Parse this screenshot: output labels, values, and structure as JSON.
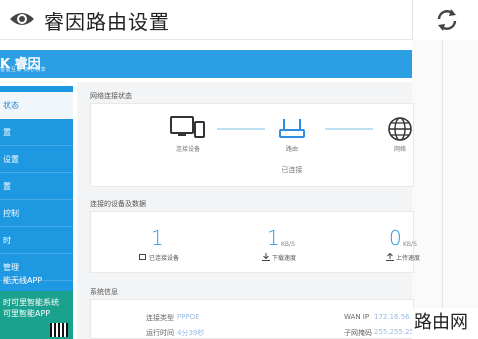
{
  "header": {
    "title": "睿因路由设置",
    "eye_icon": "eye-icon",
    "refresh_icon": "refresh-icon"
  },
  "brand": {
    "logo": "K 睿因",
    "slogan": "智能互联 随心畅享"
  },
  "sidebar": {
    "items": [
      {
        "label": "状态",
        "active": true
      },
      {
        "label": "置"
      },
      {
        "label": "设置"
      },
      {
        "label": "置"
      },
      {
        "label": "控制"
      },
      {
        "label": "时"
      },
      {
        "label": "管理"
      },
      {
        "label": "能无线APP"
      }
    ],
    "promo_line1": "时可里智能系统",
    "promo_line2": "可里智能APP"
  },
  "network_status": {
    "title": "网络连接状态",
    "device_label": "连接设备",
    "router_label": "路由",
    "internet_label": "网络",
    "state": "已连接"
  },
  "devices": {
    "title": "连接的设备及数据",
    "connected_count": "1",
    "connected_label": "已连接设备",
    "download_value": "1",
    "download_unit": "KB/S",
    "download_label": "下载速度",
    "upload_value": "0",
    "upload_unit": "KB/S",
    "upload_label": "上传速度"
  },
  "system": {
    "title": "系统信息",
    "conn_type_label": "连接类型",
    "conn_type_value": "PPPOE",
    "uptime_label": "运行时间",
    "uptime_value": "4分39秒",
    "wan_ip_label": "WAN IP",
    "wan_ip_value": "172.16.56.26",
    "subnet_label": "子网掩码",
    "subnet_value": "255.255.255.255"
  },
  "watermark": "路由网",
  "colors": {
    "primary": "#2b9ee4",
    "sidebar": "#1f98e2",
    "promo": "#1ba28e",
    "accent": "#2d9ae2"
  }
}
